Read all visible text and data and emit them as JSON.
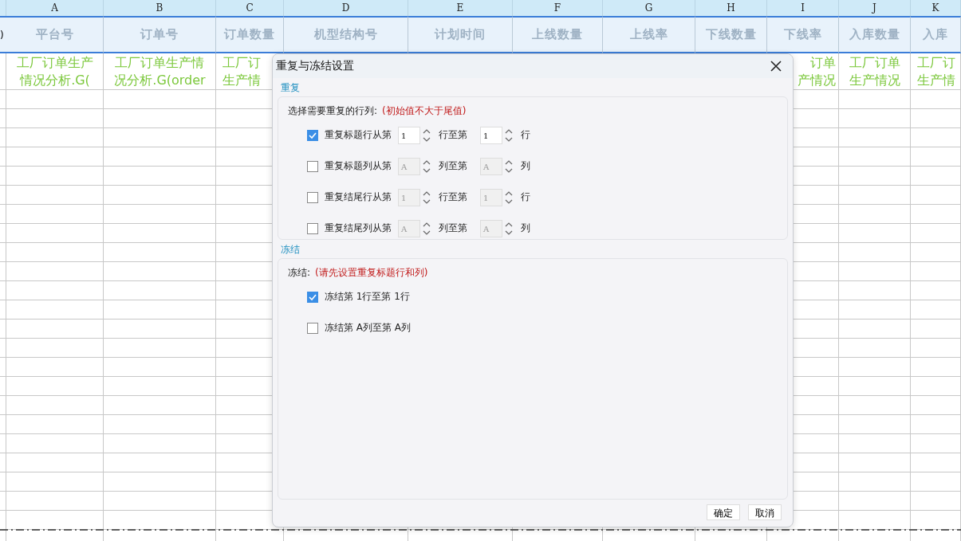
{
  "sheet": {
    "row_stub": ")",
    "column_letters": [
      "A",
      "B",
      "C",
      "D",
      "E",
      "F",
      "G",
      "H",
      "I",
      "J",
      "K"
    ],
    "header_cells": [
      "平台号",
      "订单号",
      "订单数量",
      "机型结构号",
      "计划时间",
      "上线数量",
      "上线率",
      "下线数量",
      "下线率",
      "入库数量",
      "入库"
    ],
    "data_cells": [
      {
        "lines": [
          "工厂订单生产",
          "情况分析.G("
        ]
      },
      {
        "lines": [
          "工厂订单生产情",
          "况分析.G(order"
        ]
      },
      {
        "lines": [
          "工厂订",
          "生产情"
        ]
      },
      {},
      {},
      {},
      {},
      {},
      {
        "lines": [
          "订单",
          "产情况"
        ]
      },
      {
        "lines": [
          "工厂订单",
          "生产情况"
        ]
      },
      {
        "lines": [
          "工厂订",
          "生产情"
        ]
      }
    ]
  },
  "dialog": {
    "title": "重复与冻结设置",
    "repeat": {
      "legend": "重复",
      "prompt": "选择需要重复的行列:",
      "hint": "(初始值不大于尾值)",
      "rows": [
        {
          "checked": true,
          "label": "重复标题行从第",
          "from": "1",
          "middle": "行至第",
          "to": "1",
          "end": "行"
        },
        {
          "checked": false,
          "label": "重复标题列从第",
          "from": "A",
          "middle": "列至第",
          "to": "A",
          "end": "列"
        },
        {
          "checked": false,
          "label": "重复结尾行从第",
          "from": "1",
          "middle": "行至第",
          "to": "1",
          "end": "行"
        },
        {
          "checked": false,
          "label": "重复结尾列从第",
          "from": "A",
          "middle": "列至第",
          "to": "A",
          "end": "列"
        }
      ]
    },
    "freeze": {
      "legend": "冻结",
      "prompt": "冻结:",
      "hint": "(请先设置重复标题行和列)",
      "rows": [
        {
          "checked": true,
          "label": "冻结第 1行至第 1行"
        },
        {
          "checked": false,
          "label": "冻结第 A列至第 A列"
        }
      ]
    },
    "buttons": [
      "确定",
      "取消"
    ]
  }
}
